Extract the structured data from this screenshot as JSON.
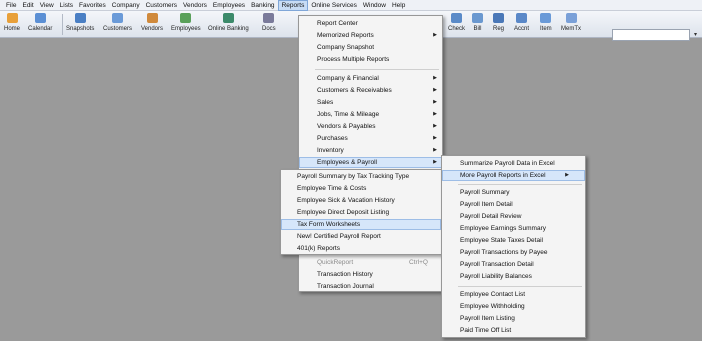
{
  "menubar": {
    "items": [
      "File",
      "Edit",
      "View",
      "Lists",
      "Favorites",
      "Company",
      "Customers",
      "Vendors",
      "Employees",
      "Banking",
      "Reports",
      "Online Services",
      "Window",
      "Help"
    ]
  },
  "toolbar": {
    "items": [
      {
        "label": "Home",
        "icon": "home-icon",
        "color": "#e8a03a"
      },
      {
        "label": "Calendar",
        "icon": "calendar-icon",
        "color": "#5b8fd4"
      },
      {
        "label": "Snapshots",
        "icon": "snapshots-icon",
        "color": "#4a7fc4"
      },
      {
        "label": "Customers",
        "icon": "customers-icon",
        "color": "#6a9ad8"
      },
      {
        "label": "Vendors",
        "icon": "vendors-icon",
        "color": "#d08a3c"
      },
      {
        "label": "Employees",
        "icon": "employees-icon",
        "color": "#5aa05a"
      },
      {
        "label": "Online Banking",
        "icon": "online-banking-icon",
        "color": "#3c8a6a"
      },
      {
        "label": "Docs",
        "icon": "docs-icon",
        "color": "#7a7a9a"
      },
      {
        "label": "Check",
        "icon": "check-icon",
        "color": "#5a8ac8"
      },
      {
        "label": "Bill",
        "icon": "bill-icon",
        "color": "#6a98d0"
      },
      {
        "label": "Reg",
        "icon": "register-icon",
        "color": "#4a78b8"
      },
      {
        "label": "Accnt",
        "icon": "account-icon",
        "color": "#5a88c8"
      },
      {
        "label": "Item",
        "icon": "item-icon",
        "color": "#6a9ad8"
      },
      {
        "label": "MemTx",
        "icon": "memorized-transaction-icon",
        "color": "#7aa0d8"
      }
    ]
  },
  "reports_menu": {
    "items": [
      {
        "label": "Report Center"
      },
      {
        "label": "Memorized Reports",
        "submenu": true
      },
      {
        "label": "Company Snapshot"
      },
      {
        "label": "Process Multiple Reports"
      },
      {
        "label": "Company & Financial",
        "submenu": true
      },
      {
        "label": "Customers & Receivables",
        "submenu": true
      },
      {
        "label": "Sales",
        "submenu": true
      },
      {
        "label": "Jobs, Time & Mileage",
        "submenu": true
      },
      {
        "label": "Vendors & Payables",
        "submenu": true
      },
      {
        "label": "Purchases",
        "submenu": true
      },
      {
        "label": "Inventory",
        "submenu": true
      },
      {
        "label": "Employees & Payroll",
        "submenu": true,
        "highlighted": true
      },
      {
        "label": "QuickReport",
        "shortcut": "Ctrl+Q",
        "disabled": true
      },
      {
        "label": "Transaction History"
      },
      {
        "label": "Transaction Journal"
      }
    ]
  },
  "payroll_submenu": {
    "items": [
      {
        "label": "Payroll Summary by Tax Tracking Type"
      },
      {
        "label": "Employee Time & Costs"
      },
      {
        "label": "Employee Sick & Vacation History"
      },
      {
        "label": "Employee Direct Deposit Listing"
      },
      {
        "label": "Tax Form Worksheets",
        "highlighted": true
      },
      {
        "label": "New! Certified Payroll Report"
      },
      {
        "label": "401(k) Reports"
      }
    ]
  },
  "excel_submenu": {
    "items": [
      {
        "label": "Summarize Payroll Data in Excel"
      },
      {
        "label": "More Payroll Reports in Excel",
        "submenu": true,
        "highlighted": true
      },
      {
        "label": "Payroll Summary"
      },
      {
        "label": "Payroll Item Detail"
      },
      {
        "label": "Payroll Detail Review"
      },
      {
        "label": "Employee Earnings Summary"
      },
      {
        "label": "Employee State Taxes Detail"
      },
      {
        "label": "Payroll Transactions by Payee"
      },
      {
        "label": "Payroll Transaction Detail"
      },
      {
        "label": "Payroll Liability Balances"
      },
      {
        "label": "Employee Contact List"
      },
      {
        "label": "Employee Withholding"
      },
      {
        "label": "Payroll Item Listing"
      },
      {
        "label": "Paid Time Off List"
      }
    ]
  }
}
